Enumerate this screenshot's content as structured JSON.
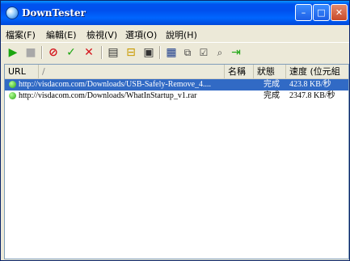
{
  "window": {
    "title": "DownTester"
  },
  "titlebar_buttons": {
    "minimize": "–",
    "maximize": "□",
    "close": "✕"
  },
  "menu": [
    "檔案(F)",
    "編輯(E)",
    "檢視(V)",
    "選項(O)",
    "說明(H)"
  ],
  "toolbar": {
    "icons": [
      "play-icon",
      "stop-icon",
      "no-icon",
      "check-icon",
      "remove-icon",
      "list-icon",
      "folder-icon",
      "window-icon",
      "save-icon",
      "copy-icon",
      "properties-icon",
      "find-icon",
      "exit-icon"
    ]
  },
  "columns": {
    "url": "URL",
    "sort": "/",
    "name": "名稱",
    "status": "狀態",
    "speed": "速度 (位元組"
  },
  "rows": [
    {
      "url": "http://visdacom.com/Downloads/USB-Safely-Remove_4....",
      "status": "完成",
      "speed": "423.8 KB/秒",
      "selected": true
    },
    {
      "url": "http://visdacom.com/Downloads/WhatInStartup_v1.rar",
      "status": "完成",
      "speed": "2347.8 KB/秒",
      "selected": false
    }
  ],
  "colors": {
    "title_bar": "#0054e3",
    "selection": "#316ac5"
  }
}
